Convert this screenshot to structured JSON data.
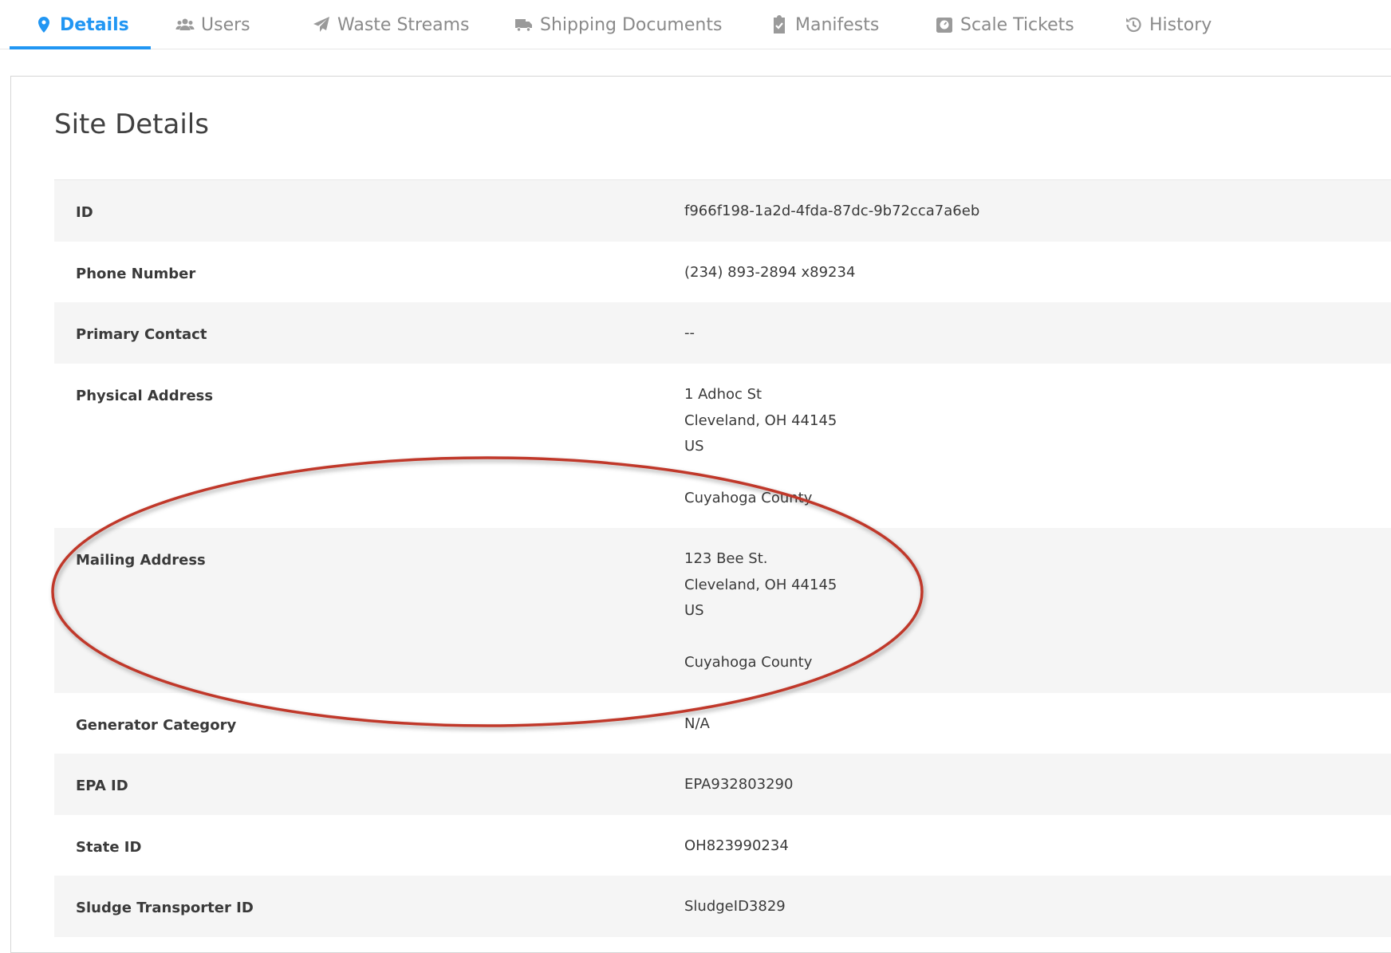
{
  "tabs": [
    {
      "label": "Details",
      "icon": "map-pin-icon",
      "active": true
    },
    {
      "label": "Users",
      "icon": "users-icon",
      "active": false
    },
    {
      "label": "Waste Streams",
      "icon": "paper-plane-icon",
      "active": false
    },
    {
      "label": "Shipping Documents",
      "icon": "truck-icon",
      "active": false
    },
    {
      "label": "Manifests",
      "icon": "clipboard-check-icon",
      "active": false
    },
    {
      "label": "Scale Tickets",
      "icon": "scale-icon",
      "active": false
    },
    {
      "label": "History",
      "icon": "history-icon",
      "active": false
    }
  ],
  "colors": {
    "accent": "#2196f3",
    "annotation": "#c0392b",
    "row_shade": "#f5f5f5"
  },
  "page": {
    "title": "Site Details"
  },
  "details": {
    "id": {
      "label": "ID",
      "value": "f966f198-1a2d-4fda-87dc-9b72cca7a6eb"
    },
    "phone": {
      "label": "Phone Number",
      "value": "(234) 893-2894 x89234"
    },
    "primary_contact": {
      "label": "Primary Contact",
      "value": "--"
    },
    "physical_address": {
      "label": "Physical Address",
      "line1": "1 Adhoc St",
      "line2": "Cleveland, OH 44145",
      "line3": "US",
      "county": "Cuyahoga County"
    },
    "mailing_address": {
      "label": "Mailing Address",
      "line1": "123 Bee St.",
      "line2": "Cleveland, OH 44145",
      "line3": "US",
      "county": "Cuyahoga County"
    },
    "generator_category": {
      "label": "Generator Category",
      "value": "N/A"
    },
    "epa_id": {
      "label": "EPA ID",
      "value": "EPA932803290"
    },
    "state_id": {
      "label": "State ID",
      "value": "OH823990234"
    },
    "sludge_transporter_id": {
      "label": "Sludge Transporter ID",
      "value": "SludgeID3829"
    }
  }
}
